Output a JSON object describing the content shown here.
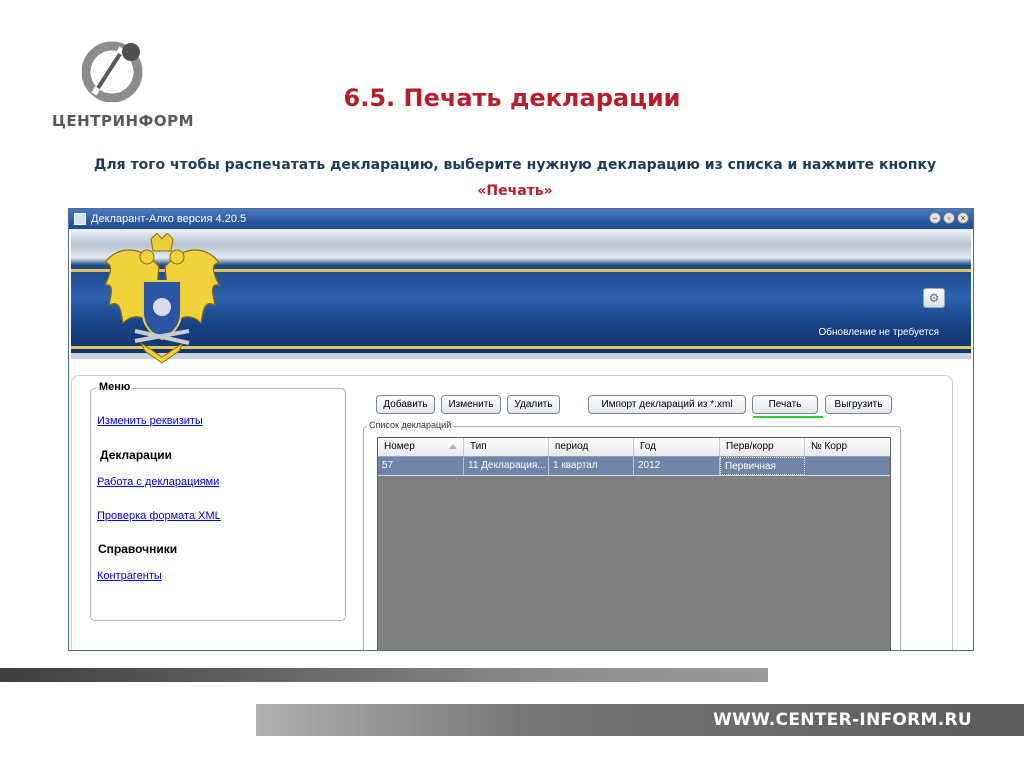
{
  "slide": {
    "logo_text": "ЦЕНТРИНФОРМ",
    "title": "6.5. Печать декларации",
    "description": "Для того чтобы распечатать декларацию, выберите нужную декларацию из списка и нажмите кнопку",
    "description_button": "«Печать»",
    "website": "WWW.CENTER-INFORM.RU"
  },
  "window": {
    "title": "Декларант-Алко версия 4.20.5",
    "controls": [
      "minimize",
      "restore",
      "close"
    ],
    "banner": {
      "update_status": "Обновление не требуется",
      "settings_icon": "settings-icon"
    }
  },
  "menu": {
    "legend": "Меню",
    "items": [
      {
        "label": "Изменить реквизиты"
      },
      {
        "section": "Декларации"
      },
      {
        "label": "Работа с декларациями"
      },
      {
        "label": "Проверка формата XML"
      },
      {
        "section": "Справочники"
      },
      {
        "label": "Контрагенты"
      }
    ]
  },
  "toolbar": {
    "add": "Добавить",
    "edit": "Изменить",
    "delete": "Удалить",
    "import": "Импорт деклараций из *.xml",
    "print": "Печать",
    "export": "Выгрузить"
  },
  "declarations": {
    "legend": "Список деклараций",
    "columns": [
      "Номер",
      "Тип",
      "период",
      "Год",
      "Перв/корр",
      "№ Корр"
    ],
    "sorted_column": "Номер",
    "rows": [
      [
        "57",
        "11 Декларация...",
        "1 квартал",
        "2012",
        "Первичная",
        ""
      ]
    ]
  },
  "colors": {
    "title_red": "#b51f2b",
    "text_blue": "#1f3b5a",
    "selected_row": "#6f84a8",
    "highlight_green": "#2fd12f"
  }
}
